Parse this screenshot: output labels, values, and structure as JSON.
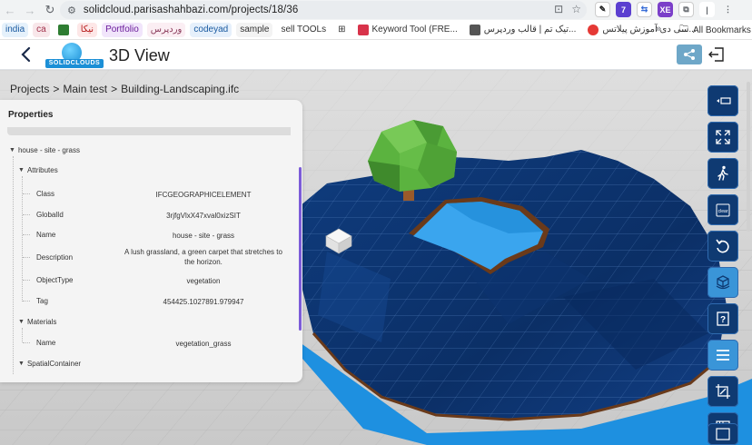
{
  "browser": {
    "url": "solidcloud.parisashahbazi.com/projects/18/36",
    "extensions": [
      "7",
      "XE"
    ]
  },
  "bookmarks": {
    "items": [
      {
        "label": "india",
        "bg": "#e5f1fb",
        "color": "#1a5aa0"
      },
      {
        "label": "ca",
        "bg": "#f8e7ea",
        "color": "#a0304a"
      },
      {
        "label": "",
        "bg": "",
        "color": "",
        "icon": "#2e7d32"
      },
      {
        "label": "نیکا",
        "bg": "#fde7e7",
        "color": "#b71c1c"
      },
      {
        "label": "Portfolio",
        "bg": "#f1e5fb",
        "color": "#6a1b9a"
      },
      {
        "label": "وردپرس",
        "bg": "#fbeef3",
        "color": "#8a3a5a"
      },
      {
        "label": "codeyad",
        "bg": "#e6f0fb",
        "color": "#1a5aa0"
      },
      {
        "label": "sample",
        "bg": "#f3f3f3",
        "color": "#333"
      },
      {
        "label": "sell TOOLs",
        "bg": "",
        "color": "#333"
      }
    ],
    "sites": [
      {
        "label": "Keyword Tool (FRE...",
        "icon": "#d8334a"
      },
      {
        "label": "تیک تم | قالب وردپرس...",
        "icon": "#555"
      },
      {
        "label": "سی دی آموزش پیلاتس...",
        "icon": "#e53935"
      }
    ],
    "all_label": "All Bookmarks"
  },
  "app": {
    "logo_text": "SOLIDCLOUDS",
    "title": "3D View"
  },
  "breadcrumb": [
    "Projects",
    "Main test",
    "Building-Landscaping.ifc"
  ],
  "properties": {
    "title": "Properties",
    "node": "house - site - grass",
    "sections": [
      {
        "name": "Attributes",
        "rows": [
          {
            "key": "Class",
            "value": "IFCGEOGRAPHICELEMENT"
          },
          {
            "key": "GlobalId",
            "value": "3rjfgVlxX47xval0xizSIT"
          },
          {
            "key": "Name",
            "value": "house - site - grass"
          },
          {
            "key": "Description",
            "value": "A lush grassland, a green carpet that stretches to the horizon."
          },
          {
            "key": "ObjectType",
            "value": "vegetation"
          },
          {
            "key": "Tag",
            "value": "454425.1027891.979947"
          }
        ]
      },
      {
        "name": "Materials",
        "rows": [
          {
            "key": "Name",
            "value": "vegetation_grass"
          }
        ]
      },
      {
        "name": "SpatialContainer",
        "rows": []
      }
    ]
  },
  "toolbar": [
    {
      "icon": "expand-icon"
    },
    {
      "icon": "fit-view-icon"
    },
    {
      "icon": "walk-icon"
    },
    {
      "icon": "clear-icon",
      "label": "clear"
    },
    {
      "icon": "undo-icon"
    },
    {
      "icon": "cube-model-icon"
    },
    {
      "icon": "help-icon"
    },
    {
      "icon": "list-icon"
    },
    {
      "icon": "crop-section-icon"
    },
    {
      "icon": "grid-plan-icon"
    },
    {
      "icon": "floor-plan-icon"
    }
  ],
  "colors": {
    "accent": "#1b8fd6",
    "toolbar_dark": "#0f3a72",
    "toolbar_light": "#3a95d8",
    "terrain": "#0e3a7a",
    "water": "#1e90e0",
    "tree": "#5bb33f"
  }
}
